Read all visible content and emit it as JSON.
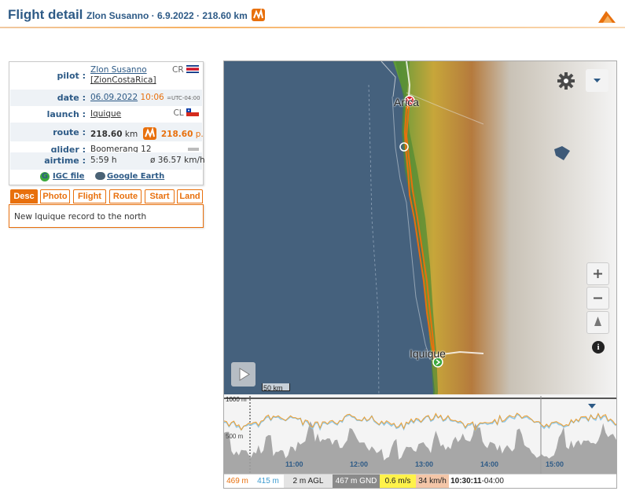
{
  "header": {
    "title": "Flight detail",
    "subtitle": "Zlon Susanno · 6.9.2022 · 218.60 km"
  },
  "flight": {
    "pilot_label": "pilot :",
    "pilot_name": "ZIon Susanno",
    "pilot_club": "[ZionCostaRica]",
    "pilot_country": "CR",
    "date_label": "date :",
    "date": "06.09.2022",
    "time": "10:06",
    "utc": "=UTC-04:00",
    "launch_label": "launch :",
    "launch": "Iquique",
    "launch_country": "CL",
    "route_label": "route :",
    "route_km": "218.60",
    "route_km_unit": "km",
    "route_points": "218.60",
    "route_points_unit": "p.",
    "glider_label": "glider :",
    "glider": "Boomerang 12",
    "airtime_label": "airtime :",
    "airtime": "5:59 h",
    "avg_speed": "ø 36.57 km/h",
    "igc_label": "IGC file",
    "google_earth_label": "Google Earth"
  },
  "tabs": [
    {
      "label": "Desc",
      "active": true
    },
    {
      "label": "Photo",
      "active": false
    },
    {
      "label": "Flight",
      "active": false
    },
    {
      "label": "Route",
      "active": false
    },
    {
      "label": "Start",
      "active": false
    },
    {
      "label": "Land",
      "active": false
    }
  ],
  "description": "New Iquique record to the north",
  "map": {
    "cities": [
      "Arica",
      "Iquique"
    ],
    "scale_label": "50 km",
    "colors": {
      "sea": "#45617d",
      "track": "#e8700d",
      "accent": "#e8700d"
    }
  },
  "chart": {
    "y_labels": [
      "1000 m",
      "500 m"
    ],
    "x_labels": [
      "11:00",
      "12:00",
      "13:00",
      "14:00",
      "15:00"
    ],
    "stats": {
      "alt_gps": "469 m",
      "alt_baro": "415 m",
      "agl": "2 m AGL",
      "gnd": "467 m GND",
      "vario": "0.6 m/s",
      "speed": "34 km/h",
      "time": "10:30:11",
      "tz": "-04:00"
    }
  }
}
